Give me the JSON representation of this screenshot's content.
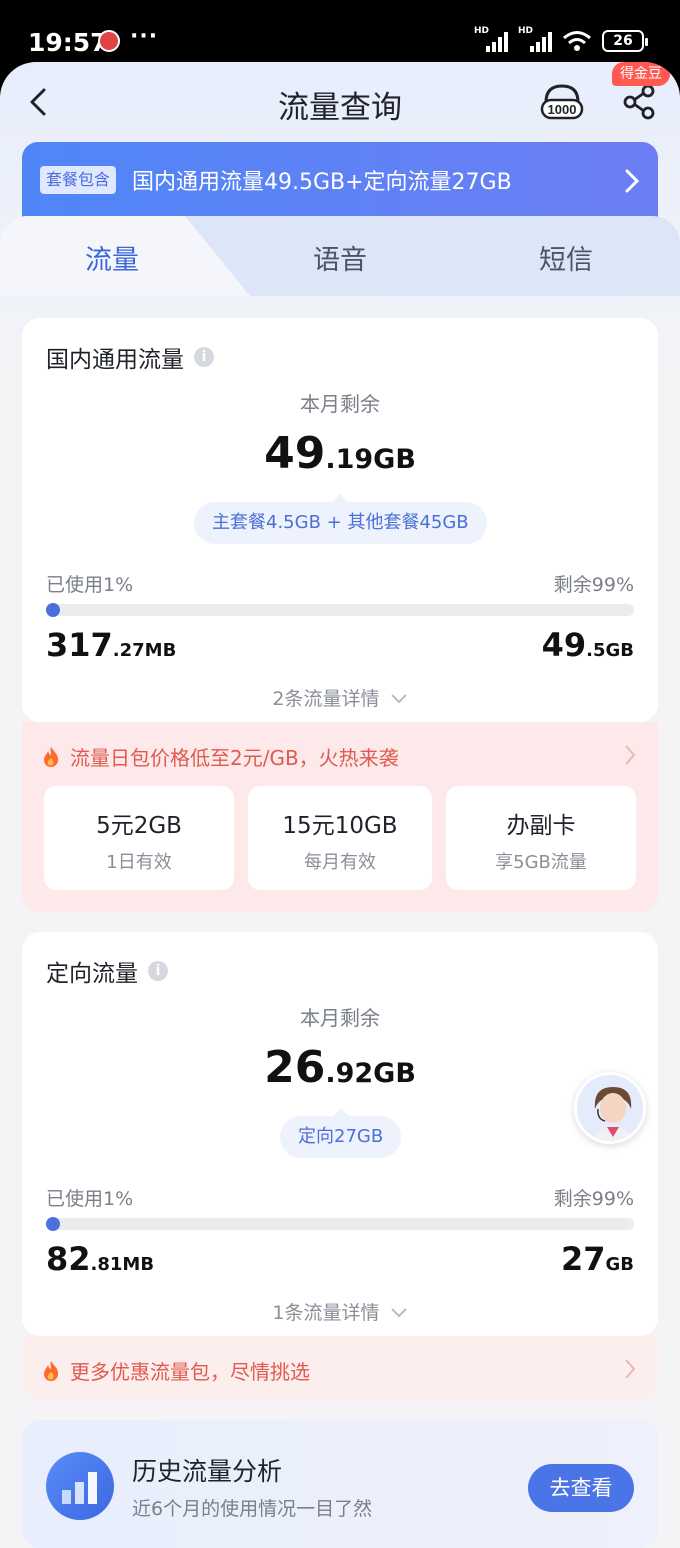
{
  "status_bar": {
    "time": "19:57",
    "more": "···",
    "hd": "HD",
    "battery": "26"
  },
  "nav": {
    "title": "流量查询",
    "service_label": "1000",
    "badge": "得金豆"
  },
  "banner": {
    "tag": "套餐包含",
    "text": "国内通用流量49.5GB+定向流量27GB"
  },
  "tabs": [
    {
      "label": "流量"
    },
    {
      "label": "语音"
    },
    {
      "label": "短信"
    }
  ],
  "general": {
    "title": "国内通用流量",
    "remain_label": "本月剩余",
    "remain_int": "49",
    "remain_dec": ".19GB",
    "breakdown": "主套餐4.5GB + 其他套餐45GB",
    "used_label": "已使用1%",
    "remaining_label": "剩余99%",
    "used_fraction": 0.01,
    "used_int": "317",
    "used_dec": ".27MB",
    "total_int": "49",
    "total_dec": ".5GB",
    "detail": "2条流量详情"
  },
  "promo1": {
    "text": "流量日包价格低至2元/GB，火热来袭",
    "offers": [
      {
        "title": "5元2GB",
        "sub": "1日有效"
      },
      {
        "title": "15元10GB",
        "sub": "每月有效"
      },
      {
        "title": "办副卡",
        "sub": "享5GB流量"
      }
    ]
  },
  "directed": {
    "title": "定向流量",
    "remain_label": "本月剩余",
    "remain_int": "26",
    "remain_dec": ".92GB",
    "breakdown": "定向27GB",
    "used_label": "已使用1%",
    "remaining_label": "剩余99%",
    "used_fraction": 0.01,
    "used_int": "82",
    "used_dec": ".81MB",
    "total_int": "27",
    "total_dec": "GB",
    "detail": "1条流量详情"
  },
  "promo2": {
    "text": "更多优惠流量包，尽情挑选"
  },
  "history": {
    "title": "历史流量分析",
    "subtitle": "近6个月的使用情况一目了然",
    "button": "去查看"
  },
  "colors": {
    "accent": "#4b74e6",
    "promo": "#e05a4f",
    "promo_bg": "#fde9e9"
  }
}
